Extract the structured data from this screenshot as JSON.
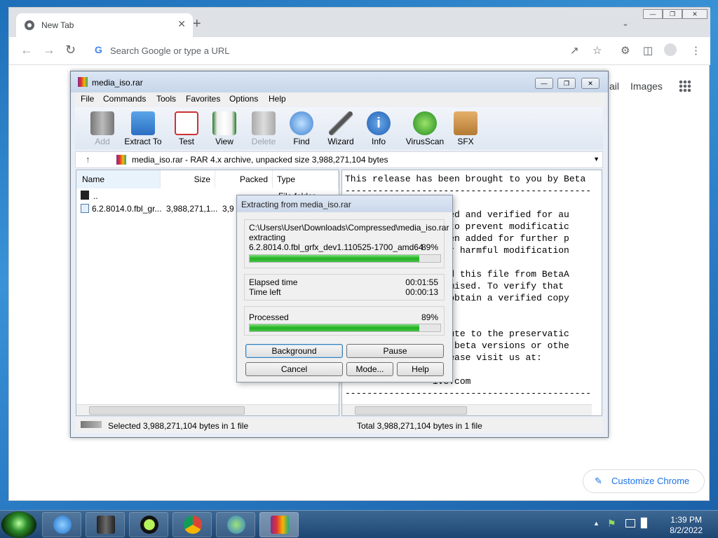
{
  "browser": {
    "tab_title": "New Tab",
    "tab_close": "✕",
    "new_tab": "+",
    "omnibox_placeholder": "Search Google or type a URL",
    "ntp_links": [
      "ail",
      "Images"
    ],
    "customize_label": "Customize Chrome"
  },
  "winrar": {
    "title": "media_iso.rar",
    "menu": [
      "File",
      "Commands",
      "Tools",
      "Favorites",
      "Options",
      "Help"
    ],
    "toolbar": [
      {
        "label": "Add",
        "icon": "add-icon",
        "enabled": false
      },
      {
        "label": "Extract To",
        "icon": "extract-folder-icon",
        "enabled": true
      },
      {
        "label": "Test",
        "icon": "test-checklist-icon",
        "enabled": true
      },
      {
        "label": "View",
        "icon": "book-icon",
        "enabled": true
      },
      {
        "label": "Delete",
        "icon": "trash-icon",
        "enabled": false
      },
      {
        "label": "Find",
        "icon": "magnifier-icon",
        "enabled": true
      },
      {
        "label": "Wizard",
        "icon": "wand-icon",
        "enabled": true
      },
      {
        "label": "Info",
        "icon": "info-icon",
        "enabled": true
      },
      {
        "label": "VirusScan",
        "icon": "bug-icon",
        "enabled": true
      },
      {
        "label": "SFX",
        "icon": "sfx-box-icon",
        "enabled": true
      }
    ],
    "address": "media_iso.rar - RAR 4.x archive, unpacked size 3,988,271,104 bytes",
    "columns": [
      "Name",
      "Size",
      "Packed",
      "Type"
    ],
    "rows": [
      {
        "name": "..",
        "size": "",
        "packed": "",
        "type": "File folder"
      },
      {
        "name": "6.2.8014.0.fbl_gr...",
        "size": "3,988,271,1...",
        "packed": "3,9",
        "type": ""
      }
    ],
    "viewer_lines": [
      "This release has been brought to you by Beta",
      "---------------------------------------------",
      "",
      "                ested and verified for au",
      "                ed to prevent modificatic",
      "                 been added for further p",
      "                ther harmful modification",
      "",
      "                load this file from BetaA",
      "                promised. To verify that",
      "                se obtain a verified copy",
      "",
      "",
      "                ribute to the preservatic",
      "                re, beta versions or othe",
      "                 please visit us at:",
      "",
      "                ive.com",
      "---------------------------------------------"
    ],
    "status_left": "Selected 3,988,271,104 bytes in 1 file",
    "status_right": "Total 3,988,271,104 bytes in 1 file"
  },
  "dialog": {
    "title": "Extracting from media_iso.rar",
    "path": "C:\\Users\\User\\Downloads\\Compressed\\media_iso.rar",
    "action": "extracting",
    "file": "6.2.8014.0.fbl_grfx_dev1.110525-1700_amd64",
    "file_percent": "89%",
    "file_progress": 0.89,
    "elapsed_label": "Elapsed time",
    "elapsed": "00:01:55",
    "left_label": "Time left",
    "left": "00:00:13",
    "processed_label": "Processed",
    "processed_percent": "89%",
    "processed_progress": 0.89,
    "buttons": {
      "background": "Background",
      "pause": "Pause",
      "cancel": "Cancel",
      "mode": "Mode...",
      "help": "Help"
    }
  },
  "taskbar": {
    "apps": [
      "internet-explorer-icon",
      "winrar-books-icon",
      "media-player-icon",
      "chrome-icon",
      "download-manager-icon",
      "winrar-icon"
    ],
    "time": "1:39 PM",
    "date": "8/2/2022"
  }
}
